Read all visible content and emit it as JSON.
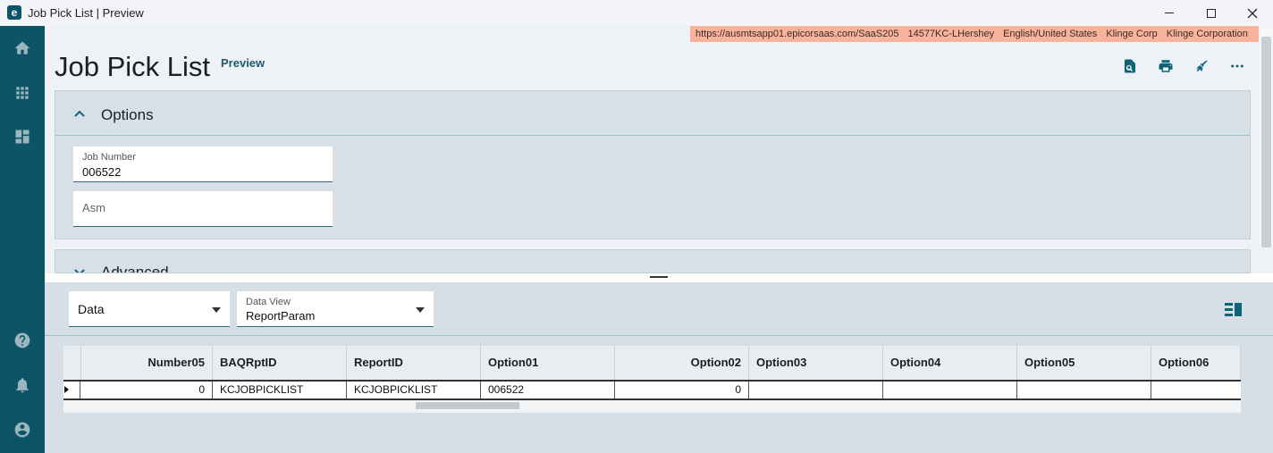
{
  "window": {
    "title": "Job Pick List | Preview",
    "icon_letter": "e"
  },
  "env_bar": {
    "url": "https://ausmtsapp01.epicorsaas.com/SaaS205",
    "user": "14577KC-LHershey",
    "language": "English/United States",
    "company": "Klinge Corp",
    "site": "Klinge Corporation",
    "color": "#f7b39c"
  },
  "header": {
    "title": "Job Pick List",
    "subtitle": "Preview"
  },
  "sidebar": {
    "items": [
      "home-icon",
      "apps-grid-icon",
      "dashboard-icon",
      "help-icon",
      "notifications-icon",
      "user-icon"
    ]
  },
  "toolbar": {
    "icons": [
      "preview-search-icon",
      "print-icon",
      "clear-broom-icon",
      "more-icon"
    ]
  },
  "options": {
    "label": "Options",
    "job_number_label": "Job Number",
    "job_number_value": "006522",
    "asm_placeholder": "Asm"
  },
  "advanced": {
    "label": "Advanced"
  },
  "data_panel": {
    "type_select": "Data",
    "data_view_label": "Data View",
    "data_view_value": "ReportParam"
  },
  "grid": {
    "columns": [
      "Number05",
      "BAQRptID",
      "ReportID",
      "Option01",
      "Option02",
      "Option03",
      "Option04",
      "Option05",
      "Option06"
    ],
    "rows": [
      [
        "0",
        "KCJOBPICKLIST",
        "KCJOBPICKLIST",
        "006522",
        "0",
        "",
        "",
        "",
        ""
      ]
    ]
  },
  "colors": {
    "sidebar": "#0d5466",
    "accent": "#0f6577",
    "panel": "#d6e0e6"
  }
}
